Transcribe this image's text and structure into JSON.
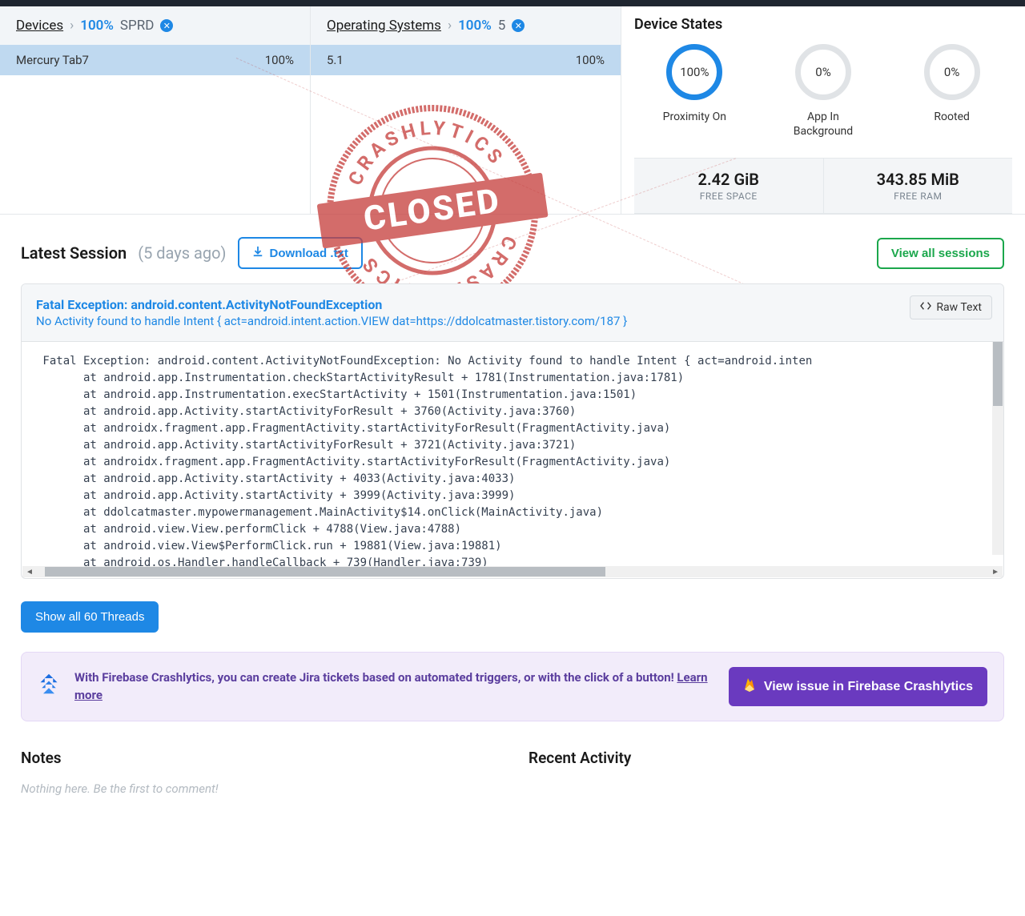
{
  "breadcrumbs": {
    "devices": {
      "label": "Devices",
      "pct": "100%",
      "term": "SPRD"
    },
    "os": {
      "label": "Operating Systems",
      "pct": "100%",
      "term": "5"
    }
  },
  "device_row": {
    "name": "Mercury Tab7",
    "pct": "100%"
  },
  "os_row": {
    "name": "5.1",
    "pct": "100%"
  },
  "states": {
    "title": "Device States",
    "gauges": [
      {
        "pct": "100%",
        "label": "Proximity On",
        "full": true
      },
      {
        "pct": "0%",
        "label": "App In Background",
        "full": false
      },
      {
        "pct": "0%",
        "label": "Rooted",
        "full": false
      }
    ],
    "mem": [
      {
        "val": "2.42 GiB",
        "lbl": "FREE SPACE"
      },
      {
        "val": "343.85 MiB",
        "lbl": "FREE RAM"
      }
    ]
  },
  "session": {
    "title": "Latest Session",
    "time": "(5 days ago)",
    "download": "Download .txt",
    "viewall": "View all sessions",
    "rawtext": "Raw Text",
    "exc_title": "Fatal Exception: android.content.ActivityNotFoundException",
    "exc_msg": "No Activity found to handle Intent { act=android.intent.action.VIEW dat=https://ddolcatmaster.tistory.com/187 }",
    "trace": " Fatal Exception: android.content.ActivityNotFoundException: No Activity found to handle Intent { act=android.inten\n       at android.app.Instrumentation.checkStartActivityResult + 1781(Instrumentation.java:1781)\n       at android.app.Instrumentation.execStartActivity + 1501(Instrumentation.java:1501)\n       at android.app.Activity.startActivityForResult + 3760(Activity.java:3760)\n       at androidx.fragment.app.FragmentActivity.startActivityForResult(FragmentActivity.java)\n       at android.app.Activity.startActivityForResult + 3721(Activity.java:3721)\n       at androidx.fragment.app.FragmentActivity.startActivityForResult(FragmentActivity.java)\n       at android.app.Activity.startActivity + 4033(Activity.java:4033)\n       at android.app.Activity.startActivity + 3999(Activity.java:3999)\n       at ddolcatmaster.mypowermanagement.MainActivity$14.onClick(MainActivity.java)\n       at android.view.View.performClick + 4788(View.java:4788)\n       at android.view.View$PerformClick.run + 19881(View.java:19881)\n       at android.os.Handler.handleCallback + 739(Handler.java:739)"
  },
  "showthreads": "Show all 60 Threads",
  "banner": {
    "text": "With Firebase Crashlytics, you can create Jira tickets based on automated triggers, or with the click of a button! ",
    "learn": "Learn more",
    "cta": "View issue in Firebase Crashlytics"
  },
  "notes": {
    "title": "Notes",
    "placeholder": "Nothing here. Be the first to comment!"
  },
  "activity": {
    "title": "Recent Activity"
  },
  "stamp": {
    "top": "CRASHLYTICS",
    "center": "CLOSED",
    "bottom": "CRASHLYTICS"
  }
}
